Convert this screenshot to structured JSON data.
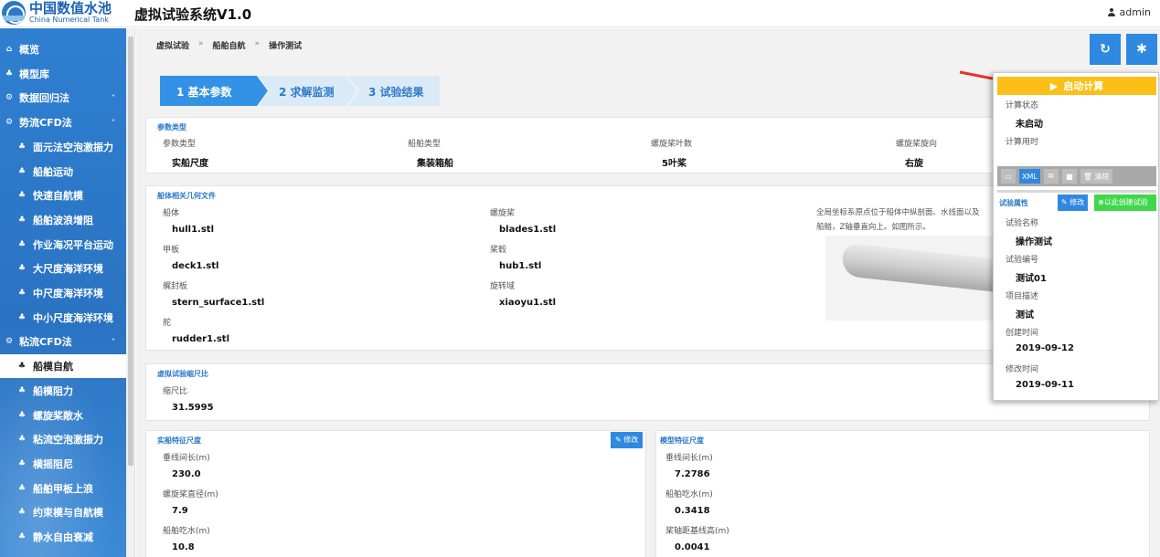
{
  "header": {
    "logo_cn": "中国数值水池",
    "logo_en": "China Numerical Tank",
    "title": "虚拟试验系统V1.0",
    "user": "admin"
  },
  "sidebar": {
    "items": [
      {
        "label": "概览",
        "icon": "home-icon",
        "level": 0
      },
      {
        "label": "模型库",
        "icon": "ship-icon",
        "level": 0
      },
      {
        "label": "数据回归法",
        "icon": "gear-icon",
        "level": 0,
        "arrow": "˅"
      },
      {
        "label": "势流CFD法",
        "icon": "gear-icon",
        "level": 0,
        "arrow": "˄"
      },
      {
        "label": "面元法空泡激振力",
        "icon": "ship-icon",
        "level": 1
      },
      {
        "label": "船舶运动",
        "icon": "ship-icon",
        "level": 1
      },
      {
        "label": "快速自航模",
        "icon": "ship-icon",
        "level": 1
      },
      {
        "label": "船舶波浪增阻",
        "icon": "ship-icon",
        "level": 1
      },
      {
        "label": "作业海况平台运动",
        "icon": "ship-icon",
        "level": 1
      },
      {
        "label": "大尺度海洋环境",
        "icon": "ship-icon",
        "level": 1
      },
      {
        "label": "中尺度海洋环境",
        "icon": "ship-icon",
        "level": 1
      },
      {
        "label": "中小尺度海洋环境",
        "icon": "ship-icon",
        "level": 1
      },
      {
        "label": "粘流CFD法",
        "icon": "gear-icon",
        "level": 0,
        "arrow": "˄"
      },
      {
        "label": "船模自航",
        "icon": "ship-icon",
        "level": 1,
        "active": true
      },
      {
        "label": "船模阻力",
        "icon": "ship-icon",
        "level": 1
      },
      {
        "label": "螺旋桨敞水",
        "icon": "ship-icon",
        "level": 1
      },
      {
        "label": "粘流空泡激振力",
        "icon": "ship-icon",
        "level": 1
      },
      {
        "label": "横摇阻尼",
        "icon": "ship-icon",
        "level": 1
      },
      {
        "label": "船舶甲板上浪",
        "icon": "ship-icon",
        "level": 1
      },
      {
        "label": "约束模与自航模",
        "icon": "ship-icon",
        "level": 1
      },
      {
        "label": "静水自由衰减",
        "icon": "ship-icon",
        "level": 1
      }
    ]
  },
  "breadcrumb": [
    "虚拟试验",
    "船舶自航",
    "操作测试"
  ],
  "breadcrumb_sep": "»",
  "top_buttons": {
    "refresh_icon": "refresh-icon",
    "settings_icon": "gear-icon"
  },
  "steps": [
    {
      "num": "1",
      "label": "基本参数"
    },
    {
      "num": "2",
      "label": "求解监测"
    },
    {
      "num": "3",
      "label": "试验结果"
    }
  ],
  "param_type": {
    "title": "参数类型",
    "fields": [
      {
        "label": "参数类型",
        "value": "实船尺度"
      },
      {
        "label": "船舶类型",
        "value": "集装箱船"
      },
      {
        "label": "螺旋桨叶数",
        "value": "5叶桨"
      },
      {
        "label": "螺旋桨旋向",
        "value": "右旋"
      }
    ]
  },
  "geometry": {
    "title": "船体相关几何文件",
    "fields": [
      {
        "label": "船体",
        "value": "hull1.stl"
      },
      {
        "label": "甲板",
        "value": "deck1.stl"
      },
      {
        "label": "艉封板",
        "value": "stern_surface1.stl"
      },
      {
        "label": "舵",
        "value": "rudder1.stl"
      },
      {
        "label": "螺旋桨",
        "value": "blades1.stl"
      },
      {
        "label": "桨毂",
        "value": "hub1.stl"
      },
      {
        "label": "旋转域",
        "value": "xiaoyu1.stl"
      }
    ],
    "note_line1": "全局坐标系原点位于船体中纵剖面、水线面以及",
    "note_line2": "船艏，Z轴垂直向上。如图所示。"
  },
  "scale": {
    "title": "虚拟试验缩尺比",
    "label": "缩尺比",
    "value": "31.5995"
  },
  "real_ship": {
    "title": "实船特征尺度",
    "edit_label": "修改",
    "fields": [
      {
        "label": "垂线间长(m)",
        "value": "230.0"
      },
      {
        "label": "螺旋桨直径(m)",
        "value": "7.9"
      },
      {
        "label": "船舶吃水(m)",
        "value": "10.8"
      }
    ]
  },
  "model_ship": {
    "title": "模型特征尺度",
    "fields": [
      {
        "label": "垂线间长(m)",
        "value": "7.2786"
      },
      {
        "label": "船舶吃水(m)",
        "value": "0.3418"
      },
      {
        "label": "桨轴距基线高(m)",
        "value": "0.0041"
      }
    ]
  },
  "panel": {
    "start_label": "启动计算",
    "status_label": "计算状态",
    "status_value": "未启动",
    "time_label": "计算用时",
    "time_value": "",
    "toolbar": {
      "xml_label": "XML",
      "clear_label": "清除"
    },
    "attr_title": "试验属性",
    "edit_label": "修改",
    "create_label": "以此创建试验",
    "fields": [
      {
        "label": "试验名称",
        "value": "操作测试"
      },
      {
        "label": "试验编号",
        "value": "测试01"
      },
      {
        "label": "项目描述",
        "value": "测试"
      },
      {
        "label": "创建时间",
        "value": "2019-09-12"
      },
      {
        "label": "修改时间",
        "value": "2019-09-11"
      }
    ]
  },
  "colors": {
    "primary": "#2f89e0",
    "start_button": "#fbbf18",
    "create_button": "#3fd84b",
    "sidebar": "#2f7fd1",
    "arrow": "#e8332a"
  }
}
